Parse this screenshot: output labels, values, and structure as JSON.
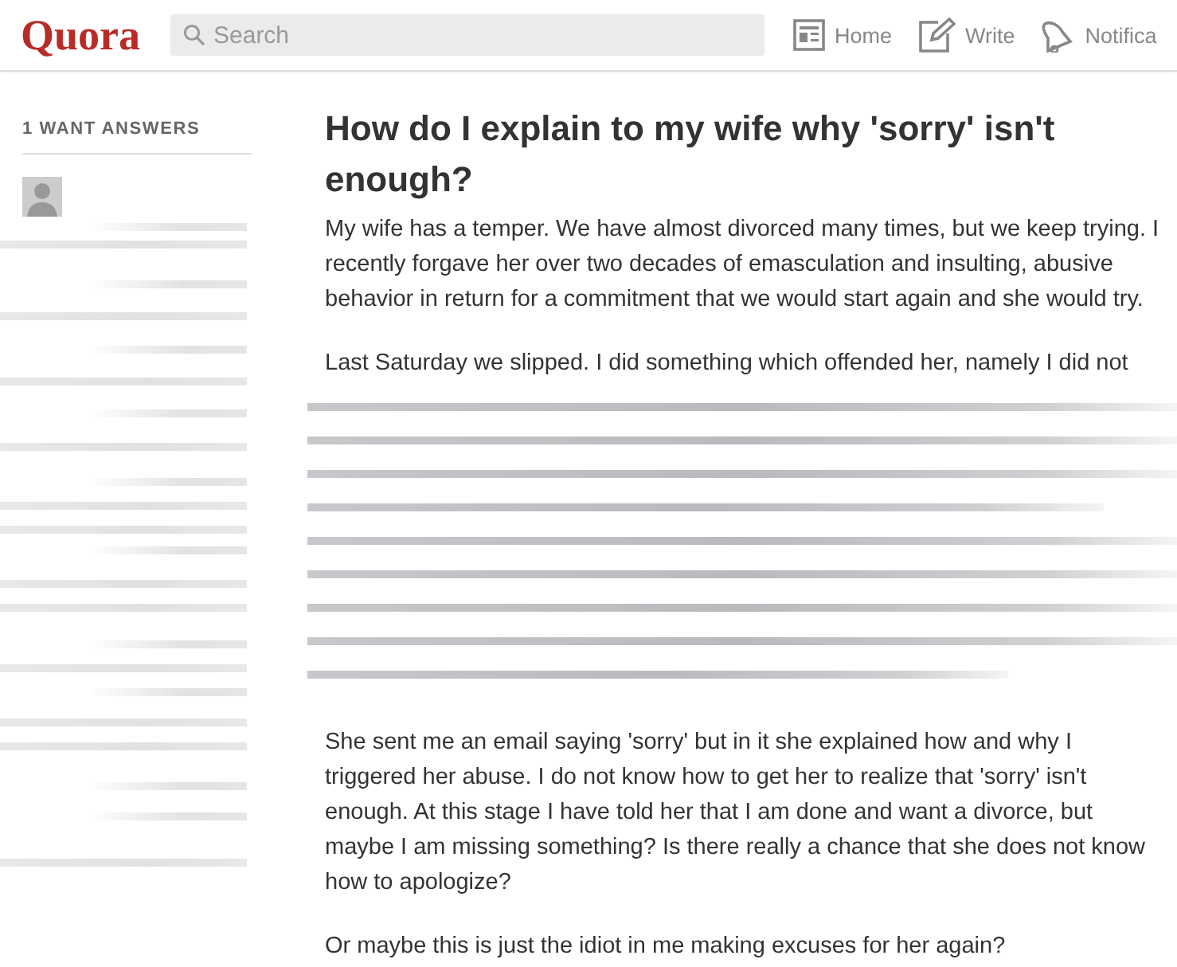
{
  "header": {
    "logo": "Quora",
    "search": {
      "placeholder": "Search"
    },
    "nav": [
      {
        "kind": "home",
        "label": "Home"
      },
      {
        "kind": "write",
        "label": "Write"
      },
      {
        "kind": "notifications",
        "label": "Notifica"
      }
    ]
  },
  "sidebar": {
    "heading": "1 WANT ANSWERS"
  },
  "question": {
    "title": "How do I explain to my wife why 'sorry' isn't enough?",
    "paragraphs_before": [
      "My wife has a temper. We have almost divorced many times, but we keep trying. I recently forgave her over two decades of emasculation and insulting, abusive behavior in return for a commitment that we would start again and she would try.",
      "Last Saturday we slipped. I did something which offended her, namely I did not"
    ],
    "paragraphs_after": [
      "She sent me an email saying 'sorry' but in it she explained how and why I triggered her abuse. I do not know how to get her to realize that 'sorry' isn't enough. At this stage I have told her that I am done and want a divorce, but maybe I am missing something? Is there really a chance that she does not know how to apologize?",
      "Or maybe this is just the idiot in me making excuses for her again?"
    ]
  }
}
